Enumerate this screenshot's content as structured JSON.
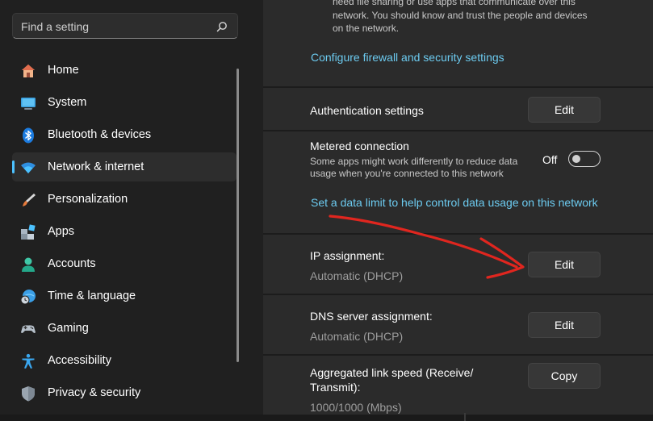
{
  "search": {
    "placeholder": "Find a setting",
    "icon": "search-icon"
  },
  "sidebar": {
    "items": [
      {
        "label": "Home",
        "icon": "home-icon",
        "active": false
      },
      {
        "label": "System",
        "icon": "system-icon",
        "active": false
      },
      {
        "label": "Bluetooth & devices",
        "icon": "bluetooth-icon",
        "active": false
      },
      {
        "label": "Network & internet",
        "icon": "wifi-icon",
        "active": true
      },
      {
        "label": "Personalization",
        "icon": "brush-icon",
        "active": false
      },
      {
        "label": "Apps",
        "icon": "apps-icon",
        "active": false
      },
      {
        "label": "Accounts",
        "icon": "accounts-icon",
        "active": false
      },
      {
        "label": "Time & language",
        "icon": "time-language-icon",
        "active": false
      },
      {
        "label": "Gaming",
        "icon": "gaming-icon",
        "active": false
      },
      {
        "label": "Accessibility",
        "icon": "accessibility-icon",
        "active": false
      },
      {
        "label": "Privacy & security",
        "icon": "shield-icon",
        "active": false
      }
    ],
    "accent_color": "#4cc2ff"
  },
  "main": {
    "network_desc": {
      "line1": "need file sharing or use apps that communicate over this",
      "line2": "network. You should know and trust the people and devices",
      "line3": "on the network."
    },
    "firewall_link": "Configure firewall and security settings",
    "authentication": {
      "title": "Authentication settings",
      "button": "Edit"
    },
    "metered": {
      "title": "Metered connection",
      "desc_line1": "Some apps might work differently to reduce data",
      "desc_line2": "usage when you're connected to this network",
      "toggle_label": "Off",
      "toggle_on": false,
      "link": "Set a data limit to help control data usage on this network"
    },
    "ip_assignment": {
      "title": "IP assignment:",
      "value": "Automatic (DHCP)",
      "button": "Edit"
    },
    "dns_assignment": {
      "title": "DNS server assignment:",
      "value": "Automatic (DHCP)",
      "button": "Edit"
    },
    "link_speed": {
      "title_line1": "Aggregated link speed (Receive/",
      "title_line2": "Transmit):",
      "value": "1000/1000 (Mbps)",
      "button": "Copy"
    },
    "link_color": "#6ccbf0",
    "annotation_color": "#e0261f"
  }
}
